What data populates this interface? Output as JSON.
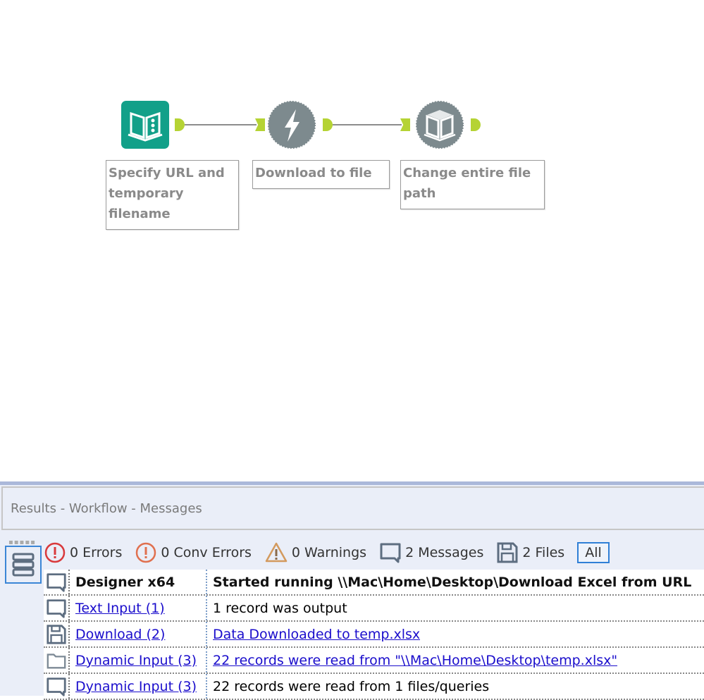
{
  "workflow": {
    "nodes": [
      {
        "label": "Specify URL and temporary filename",
        "icon": "text-input-book-icon",
        "color": "#12a089"
      },
      {
        "label": "Download to file",
        "icon": "download-lightning-icon",
        "color": "#7d8a8e"
      },
      {
        "label": "Change entire file path",
        "icon": "dynamic-input-book-icon",
        "color": "#7d8a8e"
      }
    ]
  },
  "results": {
    "title": "Results - Workflow - Messages",
    "filters": {
      "errors": "0 Errors",
      "conv_errors": "0 Conv Errors",
      "warnings": "0 Warnings",
      "messages": "2 Messages",
      "files": "2 Files",
      "all": "All"
    },
    "rows": [
      {
        "icon": "message-icon",
        "tool": "Designer x64",
        "message": "Started running \\\\Mac\\Home\\Desktop\\Download Excel from URL",
        "tool_link": false,
        "msg_link": false
      },
      {
        "icon": "message-icon",
        "tool": "Text Input (1)",
        "message": "1 record was output",
        "tool_link": true,
        "msg_link": false
      },
      {
        "icon": "file-save-icon",
        "tool": "Download (2)",
        "message": "Data Downloaded to temp.xlsx",
        "tool_link": true,
        "msg_link": true
      },
      {
        "icon": "folder-icon",
        "tool": "Dynamic Input (3)",
        "message": "22 records were read from \"\\\\Mac\\Home\\Desktop\\temp.xlsx\"",
        "tool_link": true,
        "msg_link": true
      },
      {
        "icon": "message-icon",
        "tool": "Dynamic Input (3)",
        "message": "22 records were read from 1 files/queries",
        "tool_link": true,
        "msg_link": false
      }
    ]
  }
}
